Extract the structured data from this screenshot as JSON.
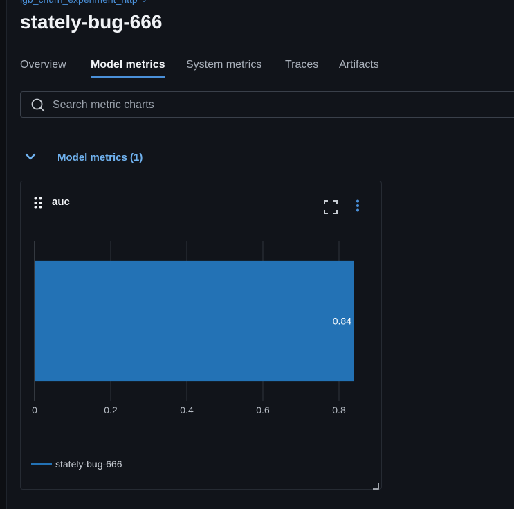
{
  "breadcrumb": {
    "text": "lgb_churn_experiment_http"
  },
  "run": {
    "title": "stately-bug-666"
  },
  "tabs": [
    {
      "label": "Overview"
    },
    {
      "label": "Model metrics"
    },
    {
      "label": "System metrics"
    },
    {
      "label": "Traces"
    },
    {
      "label": "Artifacts"
    }
  ],
  "active_tab": "Model metrics",
  "search": {
    "placeholder": "Search metric charts",
    "value": ""
  },
  "section": {
    "title": "Model metrics (1)",
    "expanded": true
  },
  "chart": {
    "title": "auc",
    "icons": [
      "drag-icon",
      "fullscreen-icon",
      "more-vertical-icon"
    ]
  },
  "colors": {
    "accent": "#4a90d9",
    "bar": "#2372b5",
    "background": "#11141a"
  },
  "chart_data": {
    "type": "bar",
    "orientation": "horizontal",
    "title": "auc",
    "categories": [
      "stately-bug-666"
    ],
    "values": [
      0.84
    ],
    "data_labels": [
      "0.84"
    ],
    "xlim": [
      0,
      0.84
    ],
    "xticks": [
      "0",
      "0.2",
      "0.4",
      "0.6",
      "0.8"
    ],
    "grid": true,
    "legend": {
      "position": "bottom-left",
      "entries": [
        "stately-bug-666"
      ]
    }
  }
}
